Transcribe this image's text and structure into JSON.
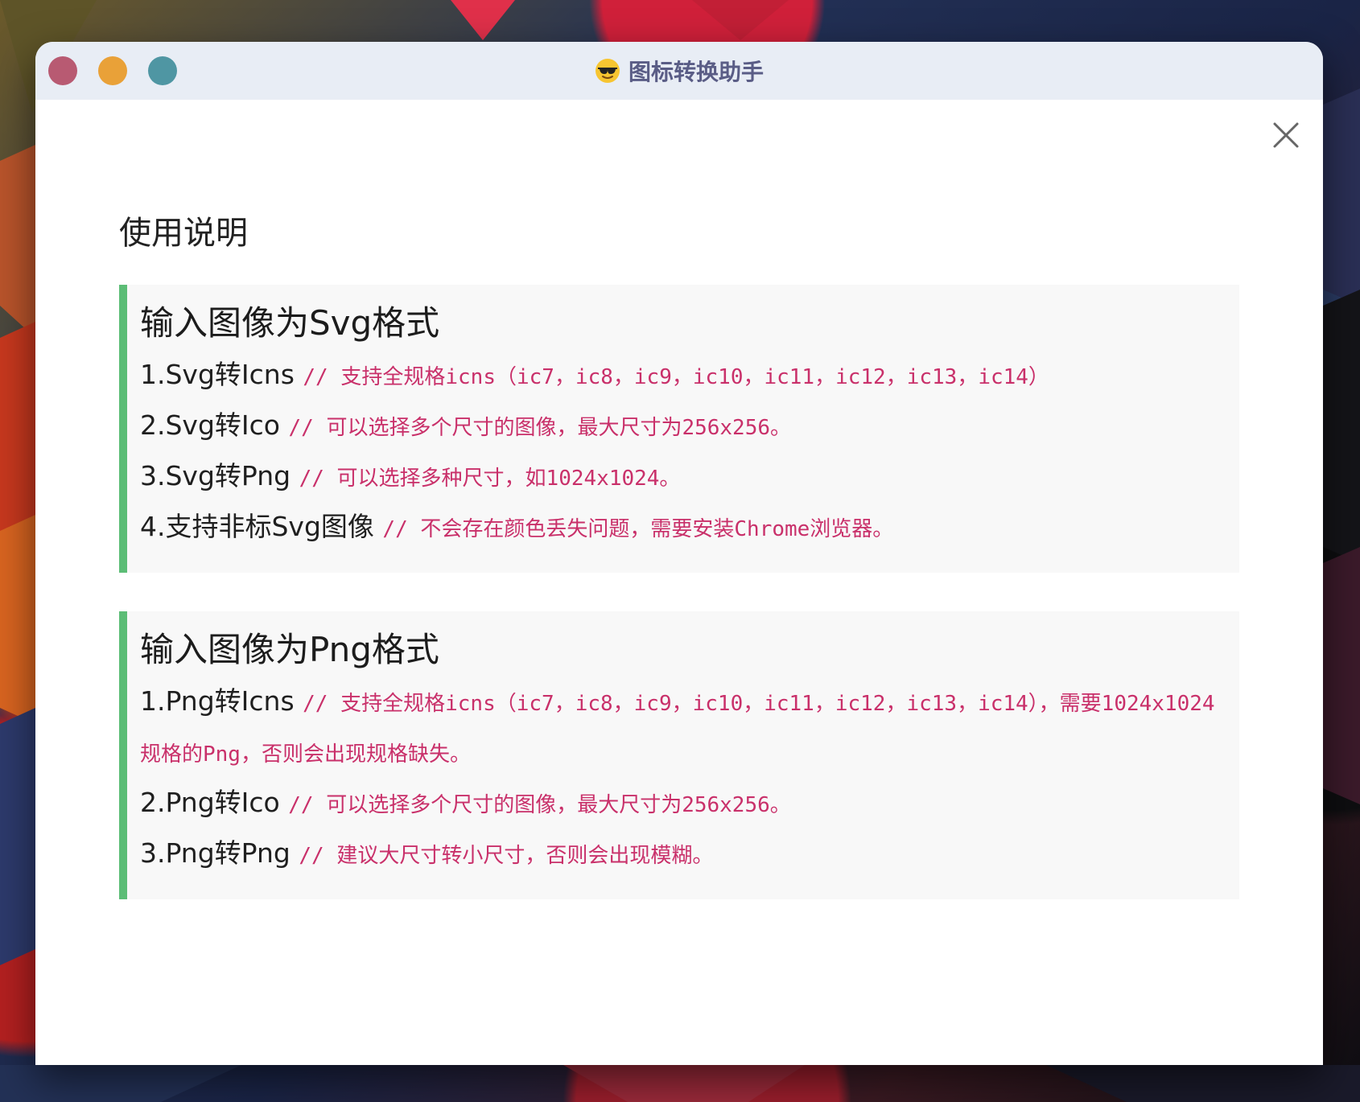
{
  "window": {
    "title": "图标转换助手",
    "title_emoji": "😎",
    "colors": {
      "titlebar_bg": "#e8edf5",
      "close_dot": "#b85a72",
      "minimize_dot": "#e9a138",
      "zoom_dot": "#4f96a3",
      "accent_border": "#5cbd76",
      "comment_text": "#c9306a"
    }
  },
  "main": {
    "heading": "使用说明",
    "close_icon": "close-x-icon",
    "sections": [
      {
        "title": "输入图像为Svg格式",
        "items": [
          {
            "label": "1.Svg转Icns",
            "comment": "// 支持全规格icns（ic7，ic8，ic9，ic10，ic11，ic12，ic13，ic14）"
          },
          {
            "label": "2.Svg转Ico",
            "comment": "// 可以选择多个尺寸的图像，最大尺寸为256x256。"
          },
          {
            "label": "3.Svg转Png",
            "comment": "// 可以选择多种尺寸，如1024x1024。"
          },
          {
            "label": "4.支持非标Svg图像",
            "comment": "// 不会存在颜色丢失问题，需要安装Chrome浏览器。"
          }
        ]
      },
      {
        "title": "输入图像为Png格式",
        "items": [
          {
            "label": "1.Png转Icns",
            "comment": "// 支持全规格icns（ic7，ic8，ic9，ic10，ic11，ic12，ic13，ic14），需要1024x1024规格的Png，否则会出现规格缺失。"
          },
          {
            "label": "2.Png转Ico",
            "comment": "// 可以选择多个尺寸的图像，最大尺寸为256x256。"
          },
          {
            "label": "3.Png转Png",
            "comment": "// 建议大尺寸转小尺寸，否则会出现模糊。"
          }
        ]
      }
    ]
  }
}
